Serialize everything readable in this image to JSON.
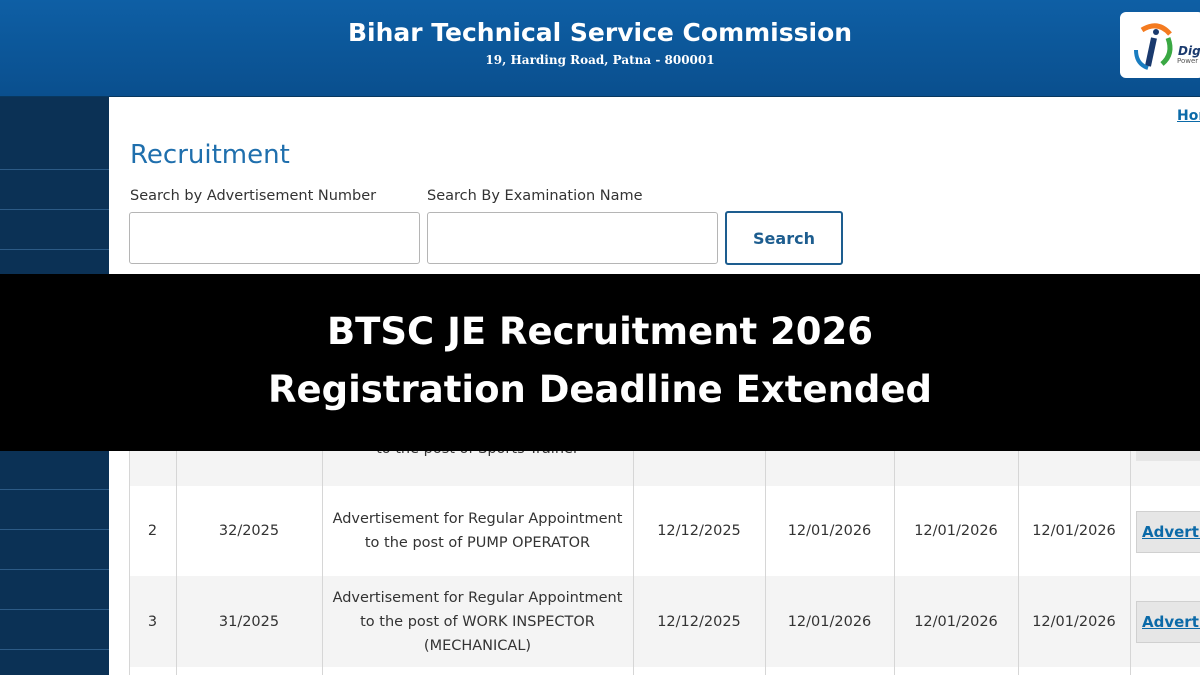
{
  "header": {
    "title": "Bihar Technical Service Commission",
    "address": "19, Harding Road, Patna - 800001",
    "logo_text": "Digit",
    "logo_tagline": "Power T",
    "logo_icon": "digital-india-logo-icon"
  },
  "nav": {
    "home_label": "Hor"
  },
  "page": {
    "title": "Recruitment",
    "search": {
      "adv_label": "Search by Advertisement Number",
      "adv_value": "",
      "exam_label": "Search By Examination Name",
      "exam_value": "",
      "button_label": "Search"
    }
  },
  "banner": {
    "line1": "BTSC JE Recruitment 2026",
    "line2": "Registration Deadline Extended"
  },
  "table": {
    "partial_row_text": "to the post of Sports Trainer",
    "rows": [
      {
        "sno": "2",
        "adv_no": "32/2025",
        "desc_line1": "Advertisement for Regular Appointment",
        "desc_line2": "to the post of PUMP OPERATOR",
        "desc_line3": "",
        "date1": "12/12/2025",
        "date2": "12/01/2026",
        "date3": "12/01/2026",
        "date4": "12/01/2026",
        "link": "Advertis"
      },
      {
        "sno": "3",
        "adv_no": "31/2025",
        "desc_line1": "Advertisement for Regular Appointment",
        "desc_line2": "to the post of WORK INSPECTOR",
        "desc_line3": "(MECHANICAL)",
        "date1": "12/12/2025",
        "date2": "12/01/2026",
        "date3": "12/01/2026",
        "date4": "12/01/2026",
        "link": "Advertis"
      }
    ]
  }
}
